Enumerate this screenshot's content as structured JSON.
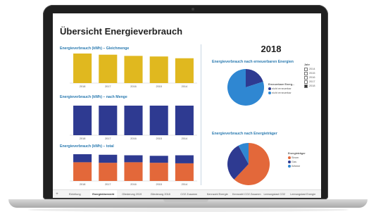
{
  "dashboard": {
    "title": "Übersicht Energieverbrauch",
    "year": "2018"
  },
  "chart_data": [
    {
      "type": "bar",
      "title": "Energieverbrauch (kWh) – Gleichmenge",
      "categories": [
        "2018",
        "2017",
        "2016",
        "2015",
        "2014"
      ],
      "series": [
        {
          "values": [
            100,
            96,
            92,
            90,
            84
          ],
          "color": "#e0b81f"
        }
      ]
    },
    {
      "type": "bar",
      "title": "Energieverbrauch (kWh) – nach Menge",
      "categories": [
        "2018",
        "2017",
        "2016",
        "2015",
        "2014"
      ],
      "series": [
        {
          "values": [
            100,
            100,
            100,
            100,
            100
          ],
          "color": "#2e3a91"
        }
      ]
    },
    {
      "type": "bar",
      "title": "Energieverbrauch (kWh) – total",
      "categories": [
        "2018",
        "2017",
        "2016",
        "2015",
        "2014"
      ],
      "series": [
        {
          "values": [
            70,
            68,
            70,
            68,
            66
          ],
          "color": "#e3683a"
        },
        {
          "values": [
            30,
            30,
            26,
            26,
            30
          ],
          "color": "#2e3a91"
        }
      ]
    },
    {
      "type": "pie",
      "title": "Energieverbrauch nach erneuerbaren Energien",
      "legend_title": "Erneuerbare Energ...",
      "legend": [
        "nicht erneuerbar",
        "nicht erneuerbar"
      ],
      "values": [
        20,
        80
      ],
      "colors": [
        "#2e3a91",
        "#2f87d2"
      ]
    },
    {
      "type": "pie",
      "title": "Energieverbrauch nach Energieträger",
      "legend_title": "Energieträger",
      "legend": [
        "Strom",
        "Gas",
        "Wärme"
      ],
      "values": [
        62,
        30,
        8
      ],
      "colors": [
        "#e3683a",
        "#2e3a91",
        "#2f87d2"
      ]
    }
  ],
  "slicer": {
    "title": "Jahr",
    "items": [
      {
        "label": "2014",
        "checked": false
      },
      {
        "label": "2015",
        "checked": false
      },
      {
        "label": "2016",
        "checked": false
      },
      {
        "label": "2017",
        "checked": false
      },
      {
        "label": "2018",
        "checked": true
      }
    ]
  },
  "tabs": [
    {
      "label": "Einleitung",
      "active": false
    },
    {
      "label": "Energieübersicht",
      "active": true
    },
    {
      "label": "Gliederung 2019",
      "active": false
    },
    {
      "label": "Gliederung 2018",
      "active": false
    },
    {
      "label": "CO2 Zusamm",
      "active": false
    },
    {
      "label": "Kennzahl Energie",
      "active": false
    },
    {
      "label": "Kennzahl CO2 Zusamm",
      "active": false
    },
    {
      "label": "Leerungslast CO2",
      "active": false
    },
    {
      "label": "Leerungslast Energie",
      "active": false
    }
  ],
  "colors": {
    "accent": "#2a7ab0",
    "gold": "#e0b81f",
    "navy": "#2e3a91",
    "orange": "#e3683a",
    "blue": "#2f87d2"
  }
}
